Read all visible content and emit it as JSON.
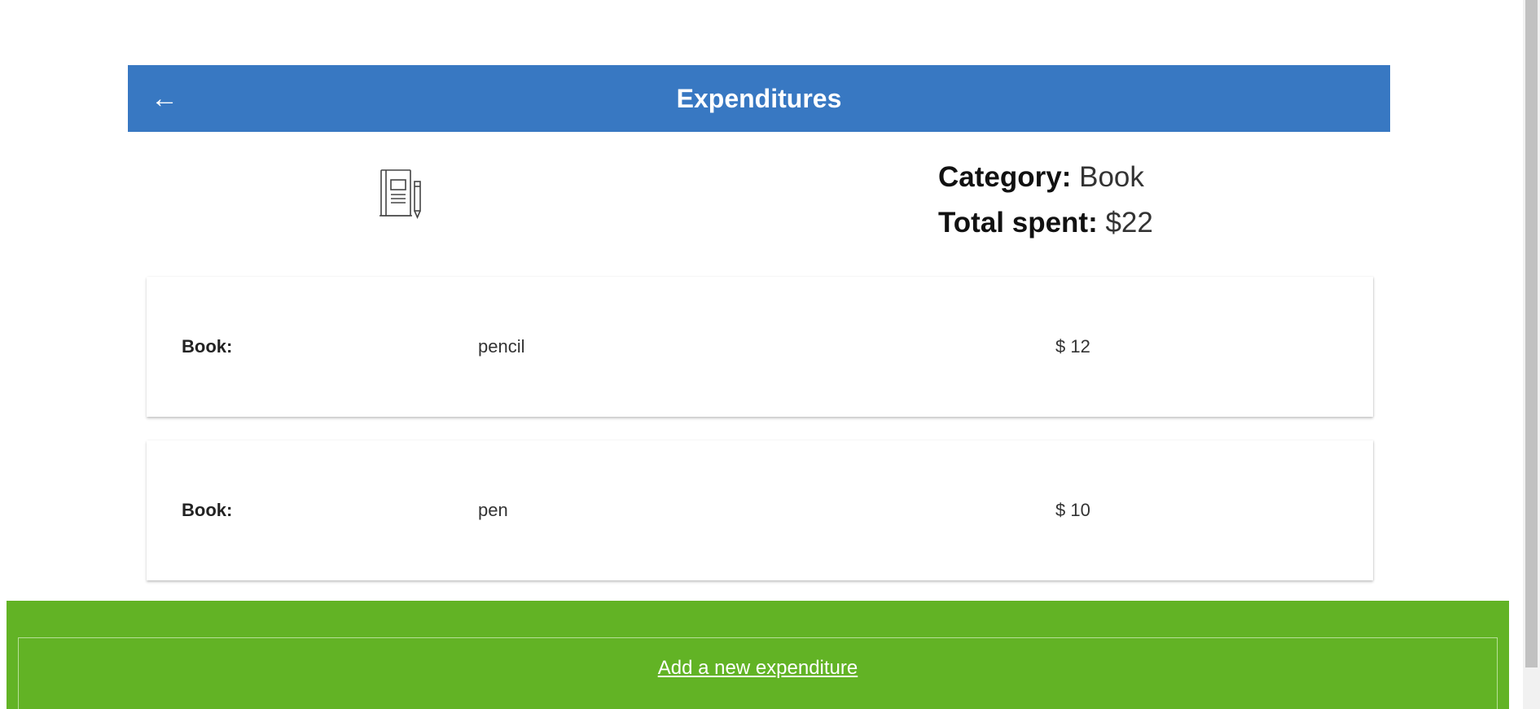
{
  "header": {
    "back_icon": "←",
    "title": "Expenditures",
    "color": "#3878c2"
  },
  "summary": {
    "icon": "notebook-pencil-icon",
    "category_label": "Category:",
    "category_value": "Book",
    "total_label": "Total spent:",
    "total_value": "$22"
  },
  "expenditures": [
    {
      "category": "Book:",
      "name": "pencil",
      "amount": "$ 12"
    },
    {
      "category": "Book:",
      "name": "pen",
      "amount": "$ 10"
    }
  ],
  "footer": {
    "add_label": "Add a new expenditure",
    "color": "#62b325"
  }
}
